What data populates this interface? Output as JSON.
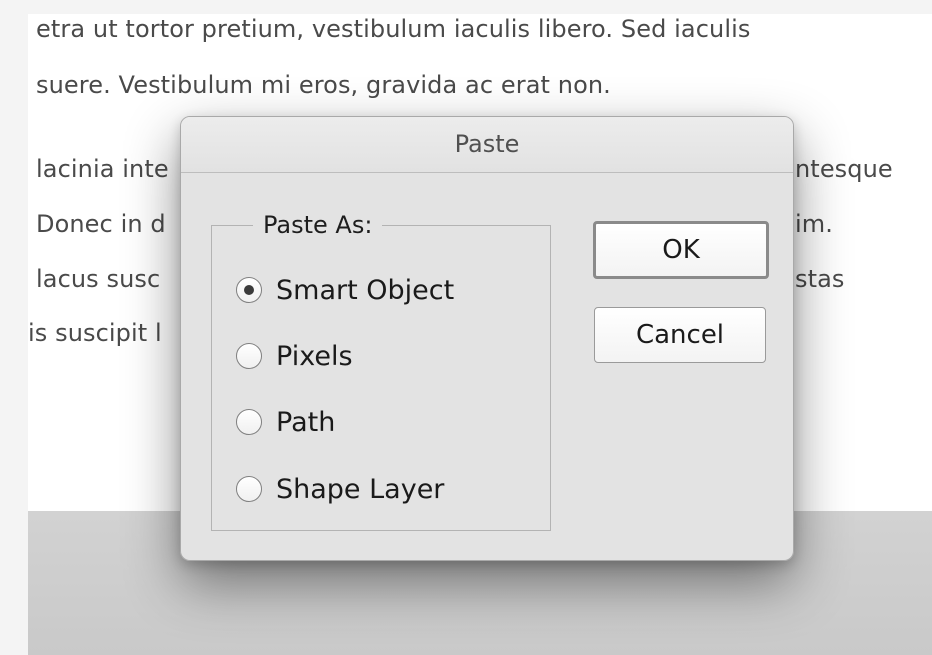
{
  "background_document": {
    "lines": [
      "etra ut tortor pretium, vestibulum iaculis libero. Sed iaculis",
      "suere. Vestibulum mi eros, gravida ac erat non.",
      "lacinia inte",
      "ntesque",
      "Donec in d",
      "im.",
      "lacus susc",
      "stas",
      "is suscipit l"
    ]
  },
  "dialog": {
    "title": "Paste",
    "group_label": "Paste As:",
    "options": [
      {
        "label": "Smart Object",
        "selected": true
      },
      {
        "label": "Pixels",
        "selected": false
      },
      {
        "label": "Path",
        "selected": false
      },
      {
        "label": "Shape Layer",
        "selected": false
      }
    ],
    "ok_label": "OK",
    "cancel_label": "Cancel"
  }
}
